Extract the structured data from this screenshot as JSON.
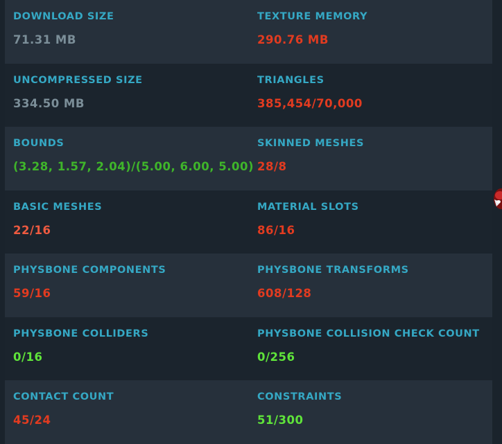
{
  "stats": [
    {
      "left": {
        "label": "DOWNLOAD SIZE",
        "value": "71.31 MB",
        "status": "gray"
      },
      "right": {
        "label": "TEXTURE MEMORY",
        "value": "290.76 MB",
        "status": "red"
      }
    },
    {
      "left": {
        "label": "UNCOMPRESSED SIZE",
        "value": "334.50 MB",
        "status": "gray"
      },
      "right": {
        "label": "TRIANGLES",
        "value": "385,454/70,000",
        "status": "red"
      }
    },
    {
      "left": {
        "label": "BOUNDS",
        "value": "(3.28, 1.57, 2.04)/(5.00, 6.00, 5.00)",
        "status": "green"
      },
      "right": {
        "label": "SKINNED MESHES",
        "value": "28/8",
        "status": "red"
      }
    },
    {
      "left": {
        "label": "BASIC MESHES",
        "value": "22/16",
        "status": "orange"
      },
      "right": {
        "label": "MATERIAL SLOTS",
        "value": "86/16",
        "status": "red"
      }
    },
    {
      "left": {
        "label": "PHYSBONE COMPONENTS",
        "value": "59/16",
        "status": "red"
      },
      "right": {
        "label": "PHYSBONE TRANSFORMS",
        "value": "608/128",
        "status": "red"
      }
    },
    {
      "left": {
        "label": "PHYSBONE COLLIDERS",
        "value": "0/16",
        "status": "lime"
      },
      "right": {
        "label": "PHYSBONE COLLISION CHECK COUNT",
        "value": "0/256",
        "status": "lime"
      }
    },
    {
      "left": {
        "label": "CONTACT COUNT",
        "value": "45/24",
        "status": "red"
      },
      "right": {
        "label": "CONSTRAINTS",
        "value": "51/300",
        "status": "lime"
      }
    }
  ],
  "colors": {
    "label": "#35a8c4",
    "gray": "#7b8e98",
    "red": "#e23b20",
    "orange": "#ee5a40",
    "green": "#3fb52a",
    "lime": "#5fe33a"
  },
  "icons": {
    "edge_thumbnail": "avatar-thumbnail-icon"
  }
}
